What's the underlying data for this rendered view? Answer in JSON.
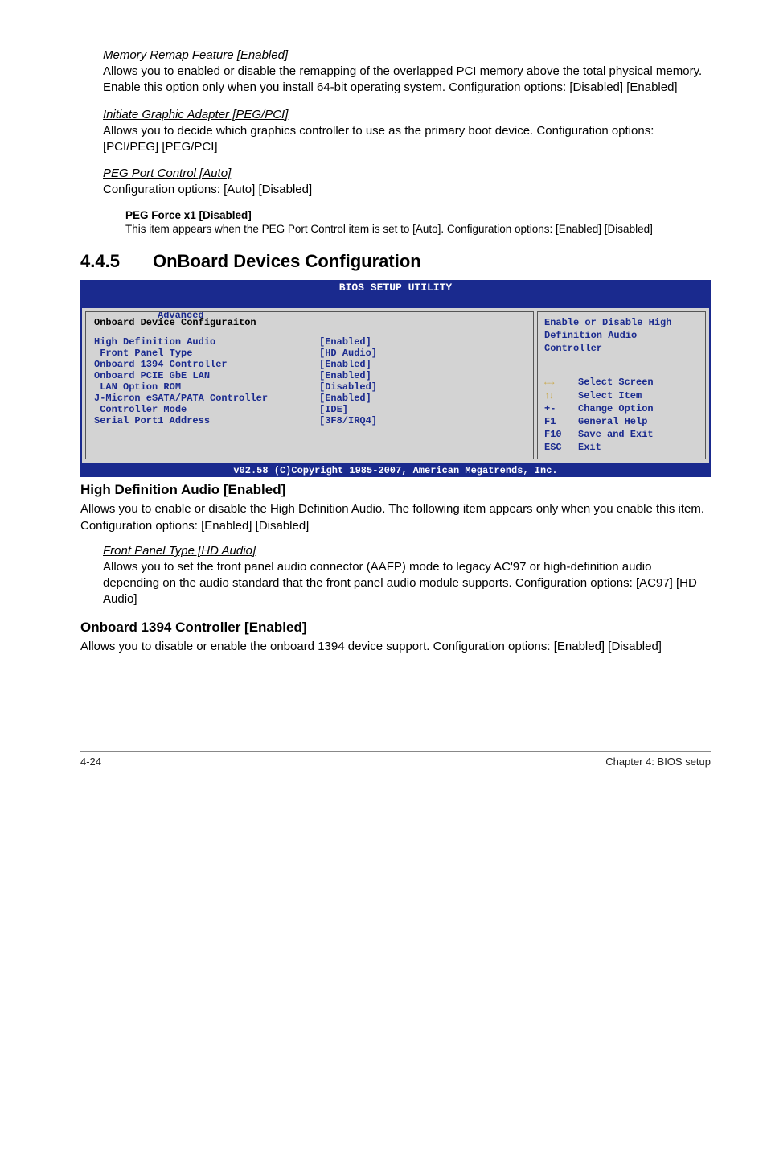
{
  "memremap": {
    "title": "Memory Remap Feature [Enabled]",
    "body": "Allows you to enabled or disable the remapping of the overlapped PCI memory above the total physical memory. Enable this option only when you install 64-bit operating system. Configuration options: [Disabled] [Enabled]"
  },
  "initgraphic": {
    "title": "Initiate Graphic Adapter [PEG/PCI]",
    "body": "Allows you to decide which graphics controller to use as the primary boot device. Configuration options: [PCI/PEG] [PEG/PCI]"
  },
  "pegport": {
    "title": "PEG Port Control [Auto]",
    "body": "Configuration options: [Auto] [Disabled]"
  },
  "pegforce": {
    "title": "PEG Force x1 [Disabled]",
    "body": "This item appears when the PEG Port Control item is set to [Auto]. Configuration options: [Enabled] [Disabled]"
  },
  "section": {
    "num": "4.4.5",
    "title": "OnBoard Devices Configuration"
  },
  "bios": {
    "utility_title": "BIOS SETUP UTILITY",
    "tab": "Advanced",
    "panel_title": "Onboard Device Configuraiton",
    "rows": [
      {
        "label": "High Definition Audio",
        "value": "[Enabled]"
      },
      {
        "label": " Front Panel Type",
        "value": "[HD Audio]"
      },
      {
        "label": "Onboard 1394 Controller",
        "value": "[Enabled]"
      },
      {
        "label": "Onboard PCIE GbE LAN",
        "value": "[Enabled]"
      },
      {
        "label": " LAN Option ROM",
        "value": "[Disabled]"
      },
      {
        "label": "J-Micron eSATA/PATA Controller",
        "value": "[Enabled]"
      },
      {
        "label": " Controller Mode",
        "value": "[IDE]"
      },
      {
        "label": "",
        "value": ""
      },
      {
        "label": "Serial Port1 Address",
        "value": "[3F8/IRQ4]"
      }
    ],
    "help_top": "Enable or Disable High Definition Audio Controller",
    "nav": [
      {
        "key_icon": "lr",
        "text": "Select Screen"
      },
      {
        "key_icon": "ud",
        "text": "Select Item"
      },
      {
        "key": "+-",
        "text": "Change Option"
      },
      {
        "key": "F1",
        "text": "General Help"
      },
      {
        "key": "F10",
        "text": "Save and Exit"
      },
      {
        "key": "ESC",
        "text": "Exit"
      }
    ],
    "footer": "v02.58 (C)Copyright 1985-2007, American Megatrends, Inc."
  },
  "hd_audio": {
    "title": "High Definition Audio [Enabled]",
    "body": "Allows you to enable or disable the High Definition Audio. The following item appears only when you enable this item.",
    "body2": "Configuration options: [Enabled] [Disabled]"
  },
  "front_panel": {
    "title": "Front Panel Type [HD Audio]",
    "body": "Allows you to set the front panel audio connector (AAFP) mode to legacy AC'97 or high-definition audio depending on the audio standard that the front panel audio module supports. Configuration options: [AC97] [HD Audio]"
  },
  "ob1394": {
    "title": "Onboard 1394 Controller [Enabled]",
    "body": "Allows you to disable or enable the onboard 1394 device support. Configuration options: [Enabled] [Disabled]"
  },
  "footer": {
    "left": "4-24",
    "right": "Chapter 4: BIOS setup"
  }
}
